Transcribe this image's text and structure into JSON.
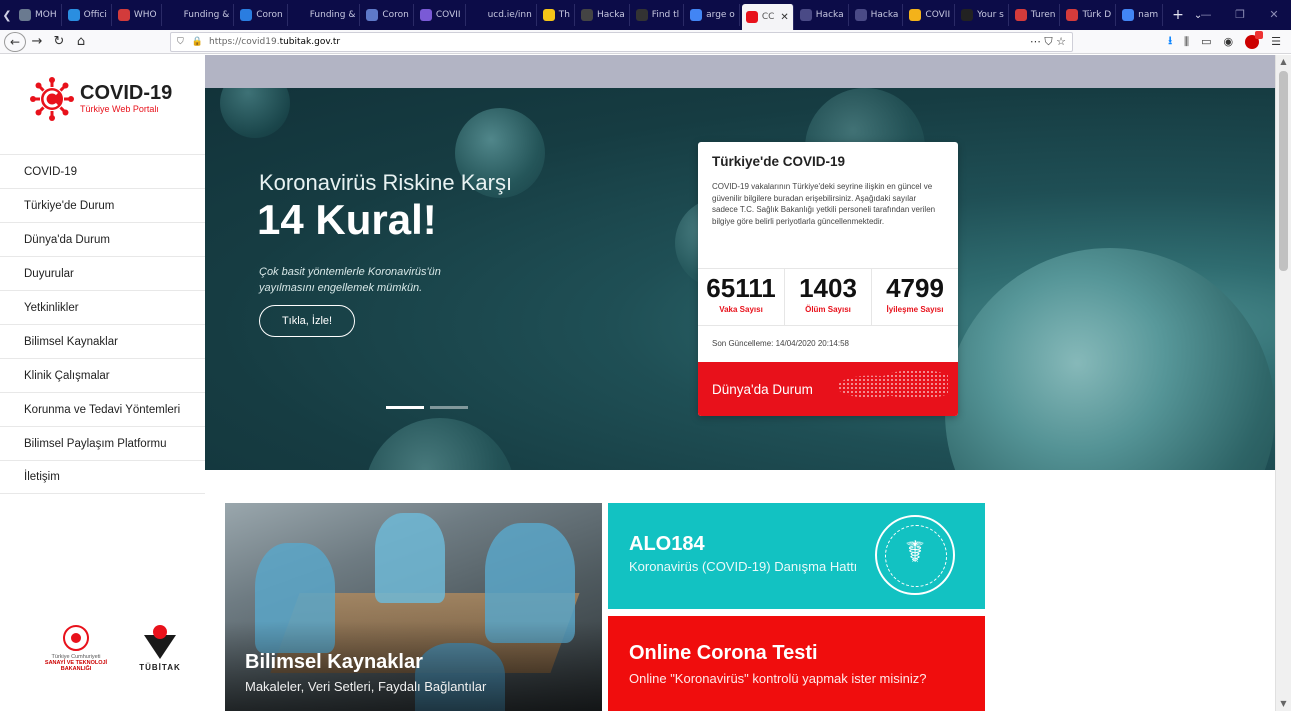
{
  "browser": {
    "tabs": [
      {
        "label": "MOH",
        "fav_color": "#6a7a90"
      },
      {
        "label": "Offici",
        "fav_color": "#2a8ee0"
      },
      {
        "label": "WHO",
        "fav_color": "#d23b3b"
      },
      {
        "label": "Funding &",
        "fav_color": "#0c0c48"
      },
      {
        "label": "Coron",
        "fav_color": "#2a7de0"
      },
      {
        "label": "Funding &",
        "fav_color": "#0c0c48"
      },
      {
        "label": "Coron",
        "fav_color": "#5e79c8"
      },
      {
        "label": "COVII",
        "fav_color": "#7a5ad6"
      },
      {
        "label": "ucd.ie/inn",
        "fav_color": "#0c0c48"
      },
      {
        "label": "Th",
        "fav_color": "#f5c518"
      },
      {
        "label": "Hacka",
        "fav_color": "#444"
      },
      {
        "label": "Find tl",
        "fav_color": "#333"
      },
      {
        "label": "arge o",
        "fav_color": "#4285f4"
      },
      {
        "label": "CC",
        "fav_color": "#e8111b",
        "active": true
      },
      {
        "label": "Hacka",
        "fav_color": "#4a4a86"
      },
      {
        "label": "Hacka",
        "fav_color": "#4a4a86"
      },
      {
        "label": "COVII",
        "fav_color": "#f3b21a"
      },
      {
        "label": "Your s",
        "fav_color": "#222"
      },
      {
        "label": "Turen",
        "fav_color": "#d43b3b"
      },
      {
        "label": "Türk D",
        "fav_color": "#d43b3b"
      },
      {
        "label": "nam",
        "fav_color": "#4285f4"
      }
    ],
    "close_tab": "✕",
    "new_tab": "+",
    "tab_menu": "⌄",
    "window_controls": {
      "minimize": "—",
      "maximize": "❐",
      "close": "✕"
    },
    "url_prefix": "https://covid19.",
    "url_host": "tubitak.gov.tr",
    "url_actions": "⋯  ⛉  ☆",
    "toolbar_right": {
      "download": "⭳",
      "library": "⫼",
      "sidebar": "▭",
      "account": "◉",
      "menu": "☰"
    }
  },
  "site": {
    "logo_title": "COVID-19",
    "logo_subtitle": "Türkiye Web Portalı",
    "menu": [
      "COVID-19",
      "Türkiye'de Durum",
      "Dünya'da Durum",
      "Duyurular",
      "Yetkinlikler",
      "Bilimsel Kaynaklar",
      "Klinik Çalışmalar",
      "Korunma ve Tedavi Yöntemleri",
      "Bilimsel Paylaşım Platformu",
      "İletişim"
    ],
    "sponsors": {
      "sanayi_line1": "Türkiye Cumhuriyeti",
      "sanayi_line2": "SANAYİ VE TEKNOLOJİ BAKANLIĞI",
      "tubitak": "TÜBİTAK"
    }
  },
  "hero": {
    "kicker": "Koronavirüs Riskine Karşı",
    "title": "14 Kural!",
    "description": "Çok basit yöntemlerle Koronavirüs'ün yayılmasını engellemek mümkün.",
    "button": "Tıkla, İzle!"
  },
  "stats_card": {
    "title": "Türkiye'de COVID-19",
    "text": "COVID-19 vakalarının Türkiye'deki seyrine ilişkin en güncel ve güvenilir bilgilere buradan erişebilirsiniz. Aşağıdaki sayılar sadece T.C. Sağlık Bakanlığı yetkili personeli tarafından verilen bilgiye göre belirli periyotlarla güncellenmektedir.",
    "stats": [
      {
        "value": "65111",
        "label": "Vaka Sayısı"
      },
      {
        "value": "1403",
        "label": "Ölüm Sayısı"
      },
      {
        "value": "4799",
        "label": "İyileşme Sayısı"
      }
    ],
    "updated": "Son Güncelleme: 14/04/2020 20:14:58",
    "world_button": "Dünya'da Durum"
  },
  "tiles": {
    "science": {
      "title": "Bilimsel Kaynaklar",
      "subtitle": "Makaleler, Veri Setleri, Faydalı Bağlantılar"
    },
    "alo": {
      "title": "ALO184",
      "subtitle": "Koronavirüs (COVID-19) Danışma Hattı"
    },
    "test": {
      "title": "Online Corona Testi",
      "subtitle": "Online \"Koronavirüs\" kontrolü yapmak ister misiniz?"
    }
  },
  "colors": {
    "brand_red": "#e8111b",
    "teal": "#12c2c2",
    "tab_bar": "#0c0c48"
  }
}
